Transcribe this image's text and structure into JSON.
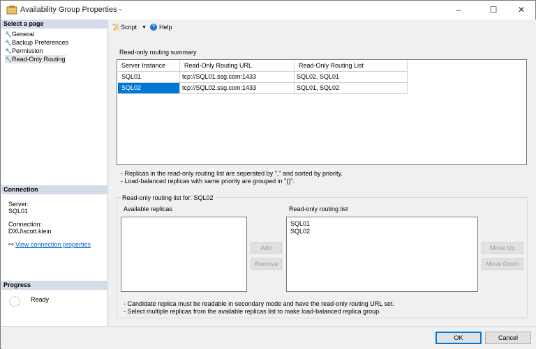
{
  "window": {
    "title": "Availability Group Properties -"
  },
  "sidebar": {
    "select_page_header": "Select a page",
    "pages": [
      {
        "label": "General"
      },
      {
        "label": "Backup Preferences"
      },
      {
        "label": "Permission"
      },
      {
        "label": "Read-Only Routing"
      }
    ],
    "connection_header": "Connection",
    "server_label": "Server:",
    "server_value": "SQL01",
    "connection_label": "Connection:",
    "connection_value": "DXU\\scott.klein",
    "view_link": "View connection properties",
    "progress_header": "Progress",
    "progress_status": "Ready"
  },
  "toolbar": {
    "script_label": "Script",
    "help_label": "Help"
  },
  "summary": {
    "title": "Read-only routing summary",
    "columns": [
      "Server Instance",
      "Read-Only Routing URL",
      "Read-Only Routing List"
    ],
    "rows": [
      {
        "instance": "SQL01",
        "url": "tcp://SQL01.ssg.com:1433",
        "list": "SQL02, SQL01"
      },
      {
        "instance": "SQL02",
        "url": "tcp://SQL02.ssg.com:1433",
        "list": "SQL01, SQL02"
      }
    ],
    "note1": "- Replicas in the read-only routing list are seperated by \",\" and sorted by priority.",
    "note2": "- Load-balanced replicas with same priority are grouped in \"()\"."
  },
  "routing": {
    "title": "Read-only routing list for: SQL02",
    "available_label": "Available replicas",
    "list_label": "Read-only routing list",
    "list_items": [
      "SQL01",
      "SQL02"
    ],
    "add_label": "Add",
    "remove_label": "Remove",
    "move_up_label": "Move Up",
    "move_down_label": "Move Down",
    "note1": "- Candidate replica must be readable in secondary mode and have the read-only routing URL set.",
    "note2": "- Select multiple replicas from the available replicas list to make load-balanced replica group."
  },
  "footer": {
    "ok_label": "OK",
    "cancel_label": "Cancel"
  },
  "colors": {
    "selection": "#0078d7",
    "section_header": "#d6dbe9",
    "link": "#0066cc"
  }
}
